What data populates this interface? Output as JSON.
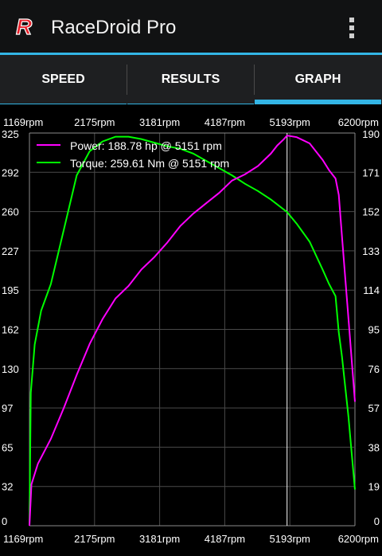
{
  "app": {
    "title": "RaceDroid Pro",
    "logo_letter": "R"
  },
  "tabs": [
    {
      "label": "SPEED",
      "selected": false
    },
    {
      "label": "RESULTS",
      "selected": false
    },
    {
      "label": "GRAPH",
      "selected": true
    }
  ],
  "colors": {
    "accent": "#33b5e5",
    "power": "#ff00ff",
    "torque": "#00ff00",
    "logo": "#e8202a"
  },
  "chart_data": {
    "type": "line",
    "x_ticks": [
      "1169rpm",
      "2175rpm",
      "3181rpm",
      "4187rpm",
      "5193rpm",
      "6200rpm"
    ],
    "x_range": [
      1169,
      6200
    ],
    "y_left_ticks": [
      "325",
      "292",
      "260",
      "227",
      "195",
      "162",
      "130",
      "97",
      "65",
      "32",
      "0"
    ],
    "y_left_range": [
      0,
      325
    ],
    "y_right_ticks": [
      "190",
      "171",
      "152",
      "133",
      "114",
      "95",
      "76",
      "57",
      "38",
      "19",
      "0"
    ],
    "y_right_range": [
      0,
      190
    ],
    "grid": true,
    "marker_rpm": 5151,
    "legend": {
      "placement": "top-left"
    },
    "series": [
      {
        "name": "Power",
        "legend_text": "Power: 188.78 hp @ 5151 rpm",
        "axis": "right",
        "x": [
          1169,
          1200,
          1300,
          1500,
          1700,
          1900,
          2100,
          2300,
          2500,
          2700,
          2900,
          3100,
          3300,
          3500,
          3700,
          3900,
          4100,
          4300,
          4500,
          4700,
          4900,
          5000,
          5100,
          5151,
          5300,
          5500,
          5700,
          5800,
          5900,
          5950,
          6000,
          6100,
          6200
        ],
        "values": [
          0,
          20,
          30,
          42,
          57,
          73,
          88,
          100,
          110,
          116,
          124,
          130,
          137,
          145,
          151,
          156,
          161,
          167,
          170,
          174,
          180,
          184,
          187,
          188.78,
          188,
          185,
          177,
          172,
          168,
          160,
          140,
          100,
          60
        ]
      },
      {
        "name": "Torque",
        "legend_text": "Torque: 259.61 Nm @ 5151 rpm",
        "axis": "left",
        "x": [
          1169,
          1190,
          1250,
          1350,
          1500,
          1700,
          1900,
          2100,
          2300,
          2500,
          2700,
          2900,
          3100,
          3300,
          3500,
          3700,
          3900,
          4100,
          4300,
          4500,
          4700,
          4900,
          5151,
          5300,
          5500,
          5700,
          5800,
          5900,
          5950,
          6000,
          6050,
          6100,
          6150,
          6200
        ],
        "values": [
          0,
          110,
          150,
          178,
          200,
          245,
          290,
          310,
          318,
          322,
          322,
          320,
          317,
          314,
          312,
          308,
          302,
          296,
          290,
          283,
          277,
          270,
          259.61,
          250,
          235,
          212,
          200,
          190,
          160,
          140,
          115,
          90,
          60,
          30
        ]
      }
    ]
  }
}
